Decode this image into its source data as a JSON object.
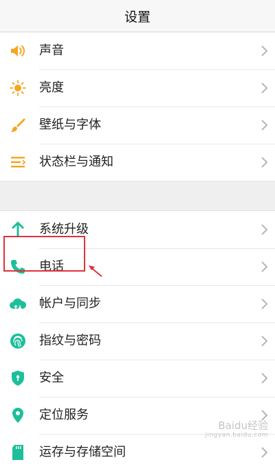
{
  "header": {
    "title": "设置"
  },
  "colors": {
    "orange": "#f5a623",
    "teal": "#1dbf9a",
    "highlight": "#e0303a"
  },
  "group1": [
    {
      "label": "声音",
      "icon": "speaker-icon"
    },
    {
      "label": "亮度",
      "icon": "sun-icon"
    },
    {
      "label": "壁纸与字体",
      "icon": "brush-icon"
    },
    {
      "label": "状态栏与通知",
      "icon": "list-icon"
    }
  ],
  "group2": [
    {
      "label": "系统升级",
      "icon": "arrow-up-icon"
    },
    {
      "label": "电话",
      "icon": "phone-icon"
    },
    {
      "label": "帐户与同步",
      "icon": "cloud-sync-icon"
    },
    {
      "label": "指纹与密码",
      "icon": "fingerprint-icon"
    },
    {
      "label": "安全",
      "icon": "shield-icon"
    },
    {
      "label": "定位服务",
      "icon": "location-pin-icon"
    },
    {
      "label": "运存与存储空间",
      "icon": "sd-card-icon"
    }
  ],
  "watermark": {
    "main": "Baidu经验",
    "sub": "jingyan.baidu.com"
  }
}
